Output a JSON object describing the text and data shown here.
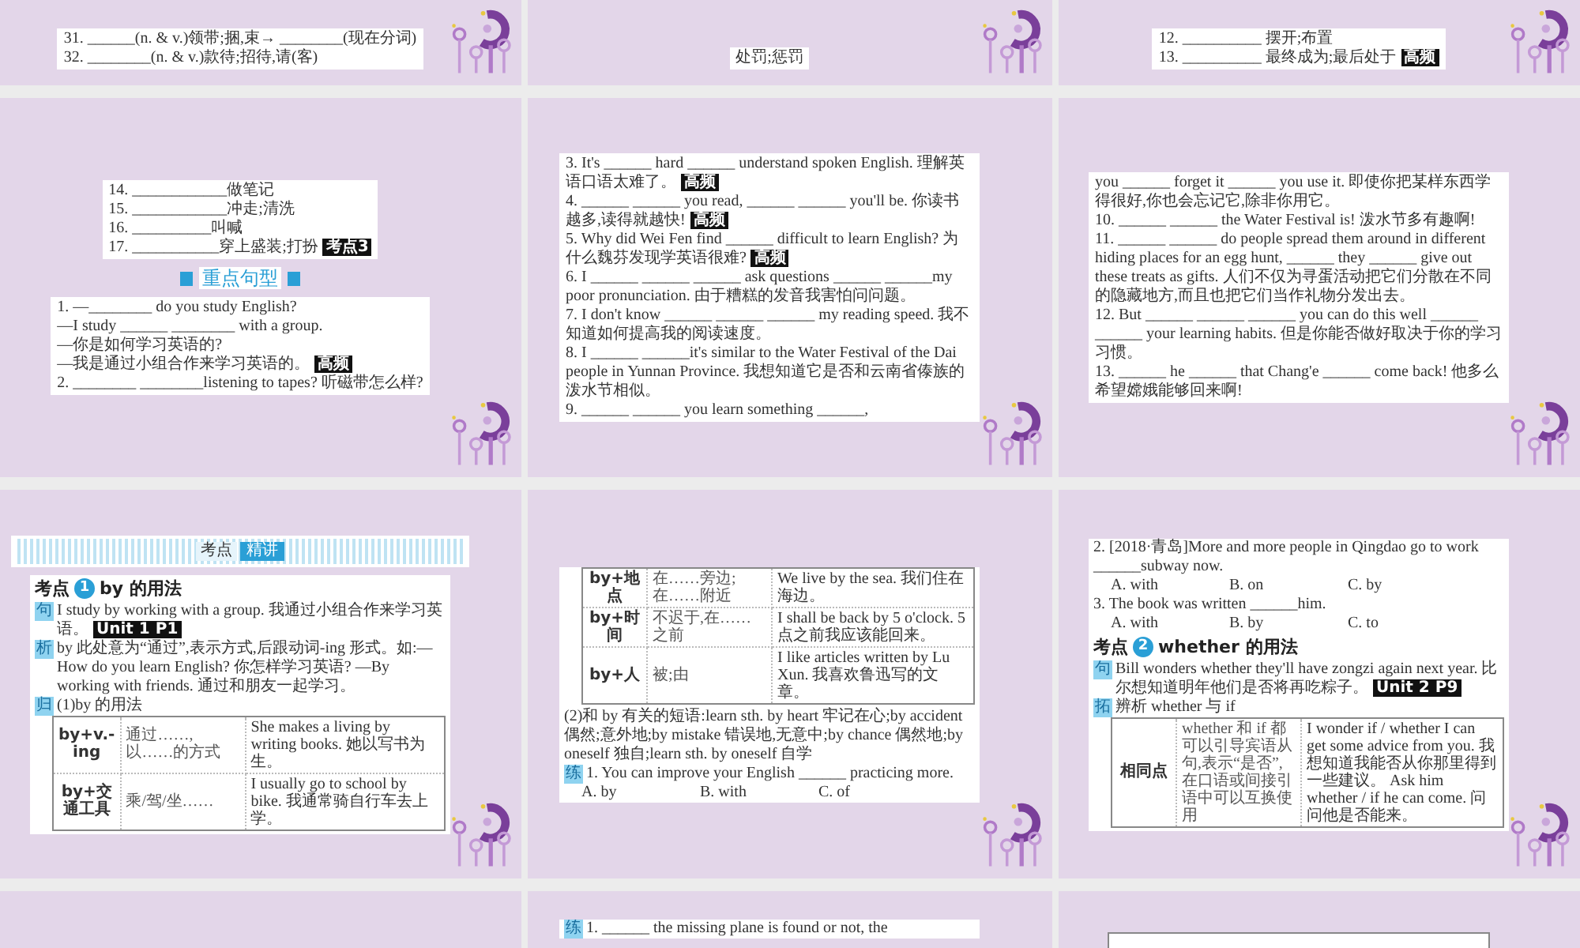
{
  "rows": [
    [
      {
        "blocks": [
          {
            "kind": "lines",
            "items": [
              {
                "text": "31. ______(n. & v.)领带;捆,束→ ________(现在分词)"
              },
              {
                "text": "32. ________(n. & v.)款待;招待,请(客)"
              }
            ]
          }
        ]
      },
      {
        "blocks": [
          {
            "kind": "lines",
            "items": [
              {
                "text": "处罚;惩罚"
              }
            ]
          }
        ]
      },
      {
        "blocks": [
          {
            "kind": "lines",
            "items": [
              {
                "text": "12. __________ 摆开;布置"
              },
              {
                "text": "13. __________ 最终成为;最后处于",
                "tag": "高频"
              }
            ]
          }
        ]
      }
    ],
    [
      {
        "blocks": [
          {
            "kind": "lines",
            "items": [
              {
                "text": "14. ____________做笔记"
              },
              {
                "text": "15. ____________冲走;清洗"
              },
              {
                "text": "16. __________叫喊"
              },
              {
                "text": "17. ___________穿上盛装;打扮",
                "tag": "考点3"
              }
            ]
          },
          {
            "kind": "heading",
            "text": "重点句型"
          },
          {
            "kind": "lines",
            "items": [
              {
                "text": "1. —________ do you study English?"
              },
              {
                "text": "—I study ______ ________ with a group."
              },
              {
                "text": "—你是如何学习英语的?"
              },
              {
                "text": "—我是通过小组合作来学习英语的。",
                "tag": "高频"
              },
              {
                "text": "2. ________ ________listening to tapes? 听磁带怎么样?"
              }
            ]
          }
        ]
      },
      {
        "blocks": [
          {
            "kind": "lines",
            "items": [
              {
                "text": "3. It's ______ hard ______ understand spoken English. 理解英语口语太难了。",
                "tag": "高频"
              },
              {
                "text": "4. ______ ______ you read, ______ ______ you'll be. 你读书越多,读得就越快!",
                "tag": "高频"
              },
              {
                "text": "5. Why did Wei Fen find ______ difficult to learn English? 为什么魏芬发现学英语很难?",
                "tag": "高频"
              },
              {
                "text": "6. I ______ ______ ______ ask questions ______ ______my poor pronunciation. 由于糟糕的发音我害怕问问题。"
              },
              {
                "text": "7. I don't know ______ ______ ______ my reading speed. 我不知道如何提高我的阅读速度。"
              },
              {
                "text": "8. I ______ ______it's similar to the Water Festival of the Dai people in Yunnan Province. 我想知道它是否和云南省傣族的泼水节相似。"
              },
              {
                "text": "9. ______ ______ you learn something ______,"
              }
            ]
          }
        ]
      },
      {
        "blocks": [
          {
            "kind": "lines",
            "items": [
              {
                "text": "you ______ forget it ______ you use it. 即使你把某样东西学得很好,你也会忘记它,除非你用它。"
              },
              {
                "text": "10. ______ ______ the Water Festival is! 泼水节多有趣啊!"
              },
              {
                "text": "11. ______ ______ do people spread them around in different hiding places for an egg hunt, ______ they ______ give out these treats as gifts. 人们不仅为寻蛋活动把它们分散在不同的隐藏地方,而且也把它们当作礼物分发出去。"
              },
              {
                "text": "12. But ______ ______ ______ you can do this well ______ ______ your learning habits. 但是你能否做好取决于你的学习习惯。"
              },
              {
                "text": "13. ______ he ______ that Chang'e ______ come back! 他多么希望嫦娥能够回来啊!"
              }
            ]
          }
        ]
      }
    ],
    [
      {
        "blocks": [
          {
            "kind": "banner",
            "label": "考点",
            "title": "精讲"
          },
          {
            "kind": "topic",
            "prefix": "考点",
            "number": "1",
            "text": "by 的用法"
          },
          {
            "kind": "note",
            "marker": "句",
            "text": "I study by working with a group. 我通过小组合作来学习英语。",
            "tag": "Unit 1 P1"
          },
          {
            "kind": "note",
            "marker": "析",
            "text": "by 此处意为“通过”,表示方式,后跟动词-ing 形式。如:—How do you learn English? 你怎样学习英语? —By working with friends. 通过和朋友一起学习。"
          },
          {
            "kind": "note",
            "marker": "归",
            "text": "(1)by 的用法"
          },
          {
            "kind": "table",
            "rows": [
              [
                "by+v.-ing",
                "通过……,以……的方式",
                "She makes a living by writing books. 她以写书为生。"
              ],
              [
                "by+交通工具",
                "乘/驾/坐……",
                "I usually go to school by bike. 我通常骑自行车去上学。"
              ]
            ]
          }
        ]
      },
      {
        "blocks": [
          {
            "kind": "table",
            "rows": [
              [
                "by+地点",
                "在……旁边;在……附近",
                "We live by the sea. 我们住在海边。"
              ],
              [
                "by+时间",
                "不迟于,在……之前",
                "I shall be back by 5 o'clock. 5点之前我应该能回来。"
              ],
              [
                "by+人",
                "被;由",
                "I like articles written by Lu Xun. 我喜欢鲁迅写的文章。"
              ]
            ]
          },
          {
            "kind": "note",
            "text": "(2)和 by 有关的短语:learn sth. by heart 牢记在心;by accident 偶然;意外地;by mistake 错误地,无意中;by chance 偶然地;by oneself 独自;learn sth. by oneself 自学"
          },
          {
            "kind": "note",
            "marker": "练",
            "text": "1. You can improve your English ______ practicing more."
          },
          {
            "kind": "options",
            "items": [
              "A. by",
              "B. with",
              "C. of"
            ]
          }
        ]
      },
      {
        "blocks": [
          {
            "kind": "note",
            "text": "2. [2018·青岛]More and more people in Qingdao go to work ______subway now."
          },
          {
            "kind": "options",
            "items": [
              "A. with",
              "B. on",
              "C. by"
            ]
          },
          {
            "kind": "note",
            "text": "3. The book was written ______him."
          },
          {
            "kind": "options",
            "items": [
              "A. with",
              "B. by",
              "C. to"
            ]
          },
          {
            "kind": "topic",
            "prefix": "考点",
            "number": "2",
            "text": "whether 的用法"
          },
          {
            "kind": "note",
            "marker": "句",
            "text": "Bill wonders whether they'll have zongzi again next year. 比尔想知道明年他们是否将再吃粽子。",
            "tag": "Unit 2 P9"
          },
          {
            "kind": "note",
            "marker": "拓",
            "text": "辨析 whether 与 if"
          },
          {
            "kind": "table",
            "rows": [
              [
                "相同点",
                "whether 和 if 都可以引导宾语从句,表示“是否”,在口语或间接引语中可以互换使用",
                "I wonder if / whether I can get some advice from you. 我想知道我能否从你那里得到一些建议。 Ask him whether / if he can come. 问问他是否能来。"
              ]
            ]
          }
        ]
      }
    ],
    [
      {},
      {
        "blocks": [
          {
            "kind": "note",
            "marker": "练",
            "text": "1. ______ the missing plane is found or not, the"
          }
        ]
      },
      {
        "blocks": [
          {
            "kind": "frame"
          }
        ]
      }
    ]
  ]
}
